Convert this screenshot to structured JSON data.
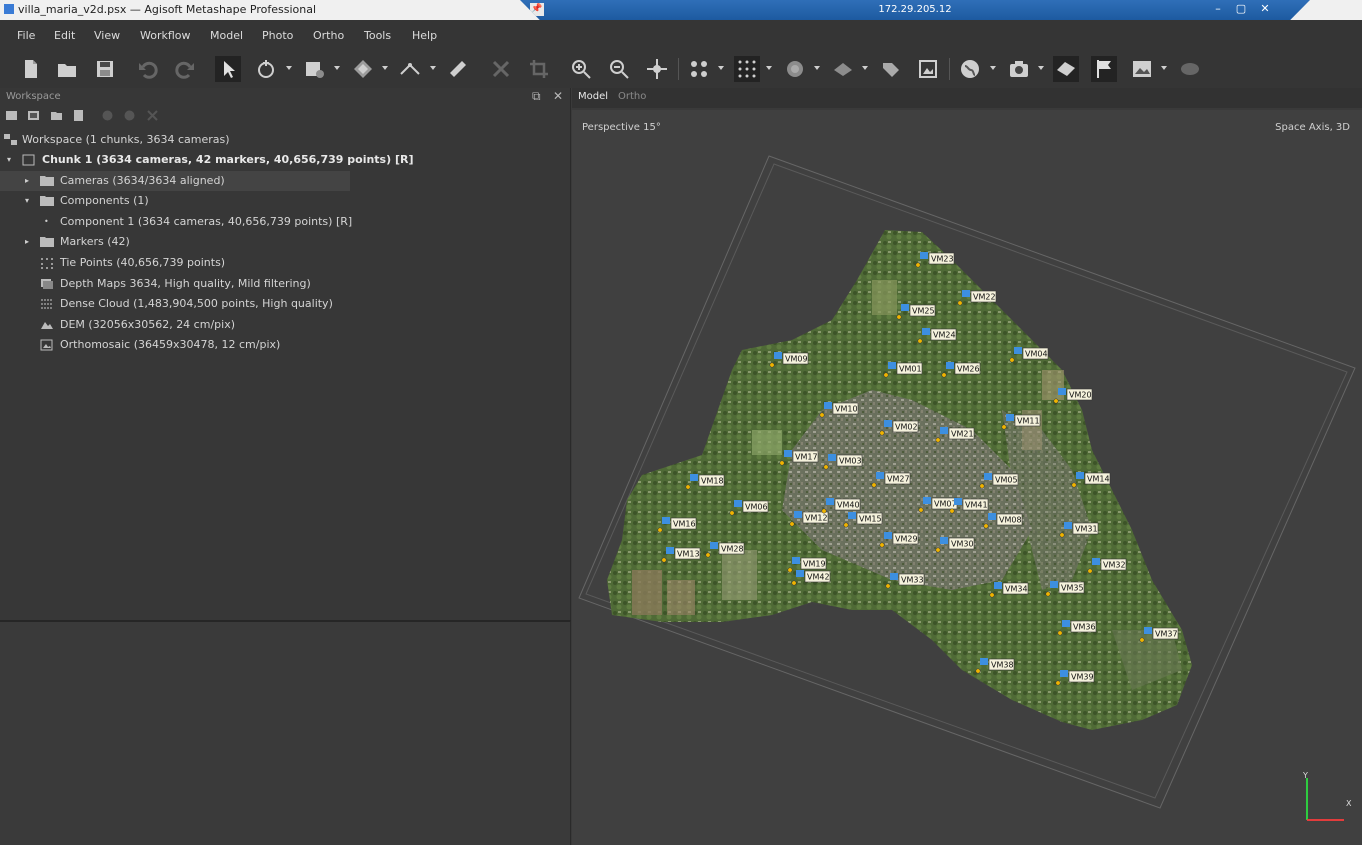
{
  "window": {
    "title": "villa_maria_v2d.psx — Agisoft Metashape Professional",
    "rdp_address": "172.29.205.12",
    "controls": [
      "–",
      "▢",
      "✕"
    ]
  },
  "menu": [
    "File",
    "Edit",
    "View",
    "Workflow",
    "Model",
    "Photo",
    "Ortho",
    "Tools",
    "Help"
  ],
  "toolbar": {
    "icons": [
      "new-document",
      "open-folder",
      "save",
      "undo",
      "redo",
      "select-pointer",
      "rotate-object",
      "region-select",
      "move-region",
      "draw-polyline",
      "ruler",
      "delete-selection",
      "crop",
      "zoom-in",
      "zoom-out",
      "navigation-pan",
      "show-cameras",
      "grid-points",
      "dense-cloud",
      "mesh",
      "texture-markers",
      "orthophoto",
      "globe",
      "camera",
      "shaded-model",
      "marker-flag",
      "image-view",
      "layers"
    ]
  },
  "workspace": {
    "title": "Workspace",
    "root": "Workspace (1 chunks, 3634 cameras)",
    "chunk": "Chunk 1 (3634 cameras, 42 markers, 40,656,739 points) [R]",
    "items": [
      {
        "label": "Cameras (3634/3634 aligned)",
        "indent": 1,
        "expand": "▸",
        "icon": "folder"
      },
      {
        "label": "Components (1)",
        "indent": 1,
        "expand": "▾",
        "icon": "folder"
      },
      {
        "label": "Component 1 (3634 cameras, 40,656,739 points) [R]",
        "indent": 2,
        "expand": "•",
        "icon": "none"
      },
      {
        "label": "Markers (42)",
        "indent": 1,
        "expand": "▸",
        "icon": "folder"
      },
      {
        "label": "Tie Points (40,656,739 points)",
        "indent": 1,
        "expand": "",
        "icon": "tiepoints"
      },
      {
        "label": "Depth Maps 3634, High quality, Mild filtering)",
        "indent": 1,
        "expand": "",
        "icon": "depthmaps"
      },
      {
        "label": "Dense Cloud (1,483,904,500 points, High quality)",
        "indent": 1,
        "expand": "",
        "icon": "densecloud"
      },
      {
        "label": "DEM (32056x30562, 24 cm/pix)",
        "indent": 1,
        "expand": "",
        "icon": "dem"
      },
      {
        "label": "Orthomosaic (36459x30478, 12 cm/pix)",
        "indent": 1,
        "expand": "",
        "icon": "ortho"
      }
    ]
  },
  "viewer": {
    "tabs": [
      "Model",
      "Ortho"
    ],
    "active_tab": "Model",
    "projection_label": "Perspective 15°",
    "axis_label": "Space Axis, 3D",
    "axis_y": "Y",
    "axis_x": "X",
    "markers": [
      "VM23",
      "VM22",
      "VM25",
      "VM24",
      "VM04",
      "VM09",
      "VM01",
      "VM26",
      "VM20",
      "VM10",
      "VM02",
      "VM21",
      "VM11",
      "VM17",
      "VM03",
      "VM27",
      "VM05",
      "VM14",
      "VM18",
      "VM06",
      "VM12",
      "VM07",
      "VM08",
      "VM15",
      "VM16",
      "VM13",
      "VM28",
      "VM19",
      "VM29",
      "VM30",
      "VM31",
      "VM32",
      "VM33",
      "VM34",
      "VM35",
      "VM36",
      "VM37",
      "VM38",
      "VM39",
      "VM40",
      "VM41",
      "VM42"
    ]
  }
}
